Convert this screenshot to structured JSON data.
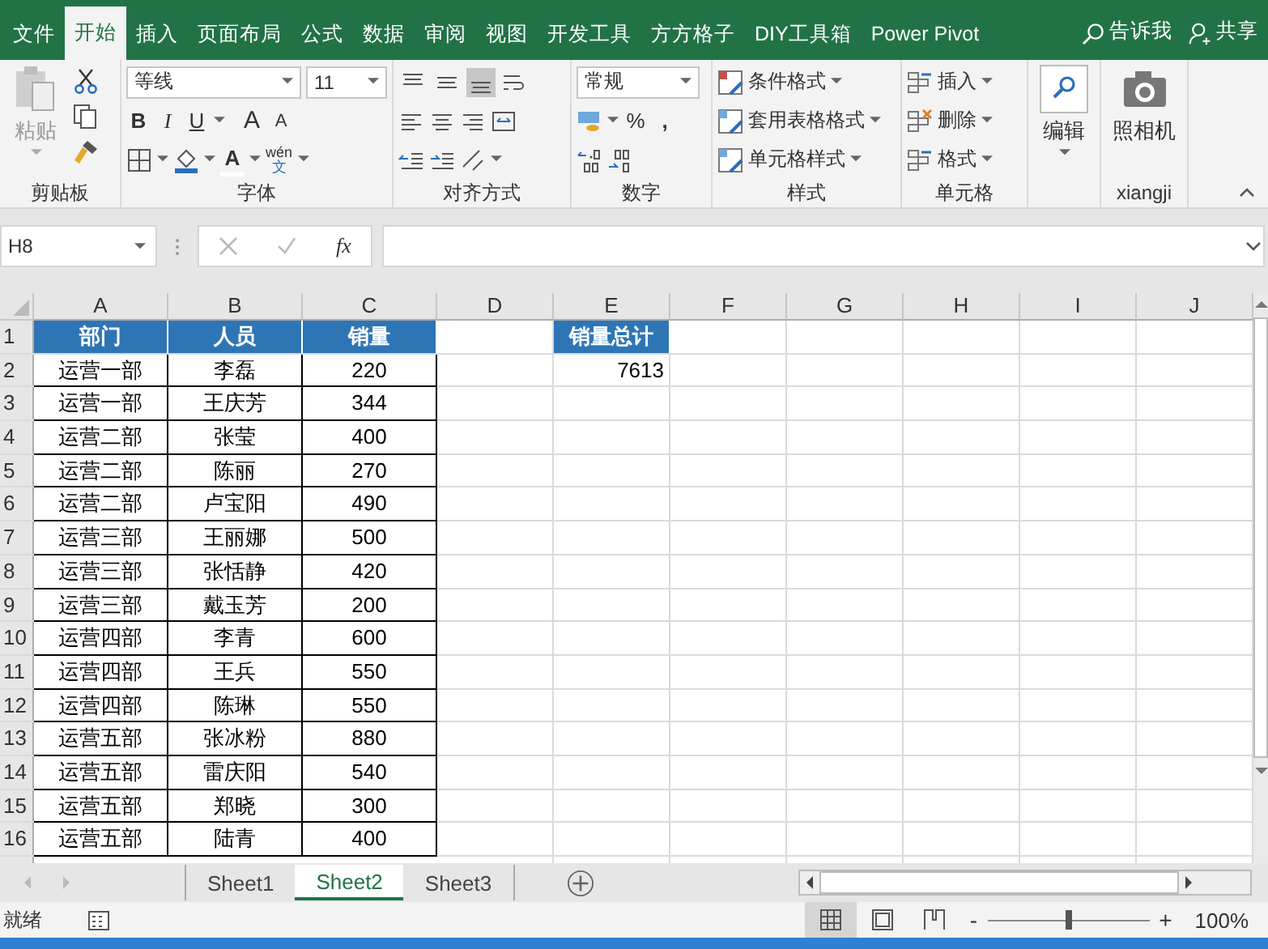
{
  "menu_tabs": [
    {
      "label": "文件",
      "selected": false
    },
    {
      "label": "开始",
      "selected": true
    },
    {
      "label": "插入",
      "selected": false
    },
    {
      "label": "页面布局",
      "selected": false
    },
    {
      "label": "公式",
      "selected": false
    },
    {
      "label": "数据",
      "selected": false
    },
    {
      "label": "审阅",
      "selected": false
    },
    {
      "label": "视图",
      "selected": false
    },
    {
      "label": "开发工具",
      "selected": false
    },
    {
      "label": "方方格子",
      "selected": false
    },
    {
      "label": "DIY工具箱",
      "selected": false
    },
    {
      "label": "Power Pivot",
      "selected": false
    }
  ],
  "tell_me": "告诉我",
  "share": "共享",
  "ribbon": {
    "clipboard": {
      "paste": "粘贴",
      "group": "剪贴板"
    },
    "font": {
      "font_name": "等线",
      "font_size": "11",
      "bold": "B",
      "italic": "I",
      "underline": "U",
      "grow": "A",
      "shrink": "A",
      "font_color": "A",
      "phonetic_top": "wén",
      "phonetic_bottom": "文",
      "group": "字体"
    },
    "alignment": {
      "vertical": [
        {
          "selected": false
        },
        {
          "selected": false
        },
        {
          "selected": true
        }
      ],
      "group": "对齐方式"
    },
    "number": {
      "format": "常规",
      "percent": "%",
      "comma": ",",
      "group": "数字"
    },
    "styles": {
      "items": [
        "条件格式",
        "套用表格格式",
        "单元格样式"
      ],
      "group": "样式"
    },
    "cells": {
      "items": [
        "插入",
        "删除",
        "格式"
      ],
      "group": "单元格"
    },
    "editing": {
      "label": "编辑"
    },
    "camera": {
      "label": "照相机",
      "group": "xiangji"
    }
  },
  "formula_bar": {
    "name_box": "H8",
    "fx": "fx"
  },
  "columns": [
    "A",
    "B",
    "C",
    "D",
    "E",
    "F",
    "G",
    "H",
    "I",
    "J"
  ],
  "row_numbers": [
    "1",
    "2",
    "3",
    "4",
    "5",
    "6",
    "7",
    "8",
    "9",
    "10",
    "11",
    "12",
    "13",
    "14",
    "15",
    "16"
  ],
  "table": {
    "header": [
      "部门",
      "人员",
      "销量"
    ],
    "rows": [
      [
        "运营一部",
        "李磊",
        "220"
      ],
      [
        "运营一部",
        "王庆芳",
        "344"
      ],
      [
        "运营二部",
        "张莹",
        "400"
      ],
      [
        "运营二部",
        "陈丽",
        "270"
      ],
      [
        "运营二部",
        "卢宝阳",
        "490"
      ],
      [
        "运营三部",
        "王丽娜",
        "500"
      ],
      [
        "运营三部",
        "张恬静",
        "420"
      ],
      [
        "运营三部",
        "戴玉芳",
        "200"
      ],
      [
        "运营四部",
        "李青",
        "600"
      ],
      [
        "运营四部",
        "王兵",
        "550"
      ],
      [
        "运营四部",
        "陈琳",
        "550"
      ],
      [
        "运营五部",
        "张冰粉",
        "880"
      ],
      [
        "运营五部",
        "雷庆阳",
        "540"
      ],
      [
        "运营五部",
        "郑晓",
        "300"
      ],
      [
        "运营五部",
        "陆青",
        "400"
      ]
    ]
  },
  "summary": {
    "label": "销量总计",
    "value": "7613"
  },
  "sheet_tabs": [
    {
      "label": "Sheet1",
      "selected": false
    },
    {
      "label": "Sheet2",
      "selected": true
    },
    {
      "label": "Sheet3",
      "selected": false
    }
  ],
  "status_bar": {
    "status": "就绪",
    "zoom_minus": "-",
    "zoom_plus": "+",
    "zoom": "100%",
    "zoom_level": {
      "level": 0.5
    }
  }
}
